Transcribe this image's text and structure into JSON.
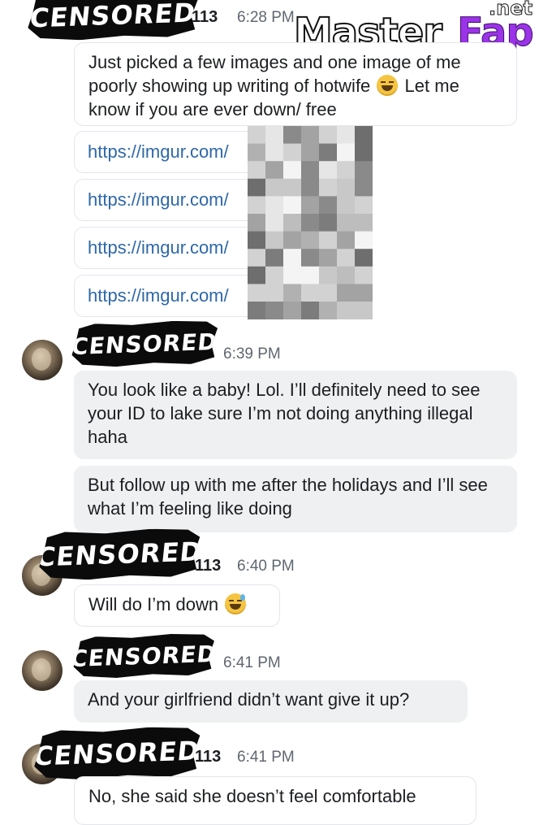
{
  "watermark": {
    "master": "Master",
    "fap": "Fap",
    "net": ".net"
  },
  "censor_label": "CENSORED",
  "messages": [
    {
      "sender_suffix": "113",
      "time": "6:28 PM",
      "text": "Just picked a few images and one image of me poorly showing up writing of hotwife",
      "text_after_emoji": "Let me know if you are ever down/ free",
      "emoji": "laughing-emoji"
    },
    {
      "link": "https://imgur.com/"
    },
    {
      "link": "https://imgur.com/"
    },
    {
      "link": "https://imgur.com/"
    },
    {
      "link": "https://imgur.com/"
    },
    {
      "time": "6:39 PM",
      "text": "You look like a baby! Lol. I’ll definitely need to see your ID to lake sure I’m not doing anything illegal haha"
    },
    {
      "text": "But follow up with me after the holidays and I’ll see what I’m feeling like doing"
    },
    {
      "sender_suffix": "113",
      "time": "6:40 PM",
      "text": "Will do I’m down",
      "emoji": "sweat-smile-emoji"
    },
    {
      "time": "6:41 PM",
      "text": "And your girlfriend didn’t want give it up?"
    },
    {
      "sender_suffix": "113",
      "time": "6:41 PM",
      "text": "No, she said she doesn’t feel comfortable"
    }
  ]
}
